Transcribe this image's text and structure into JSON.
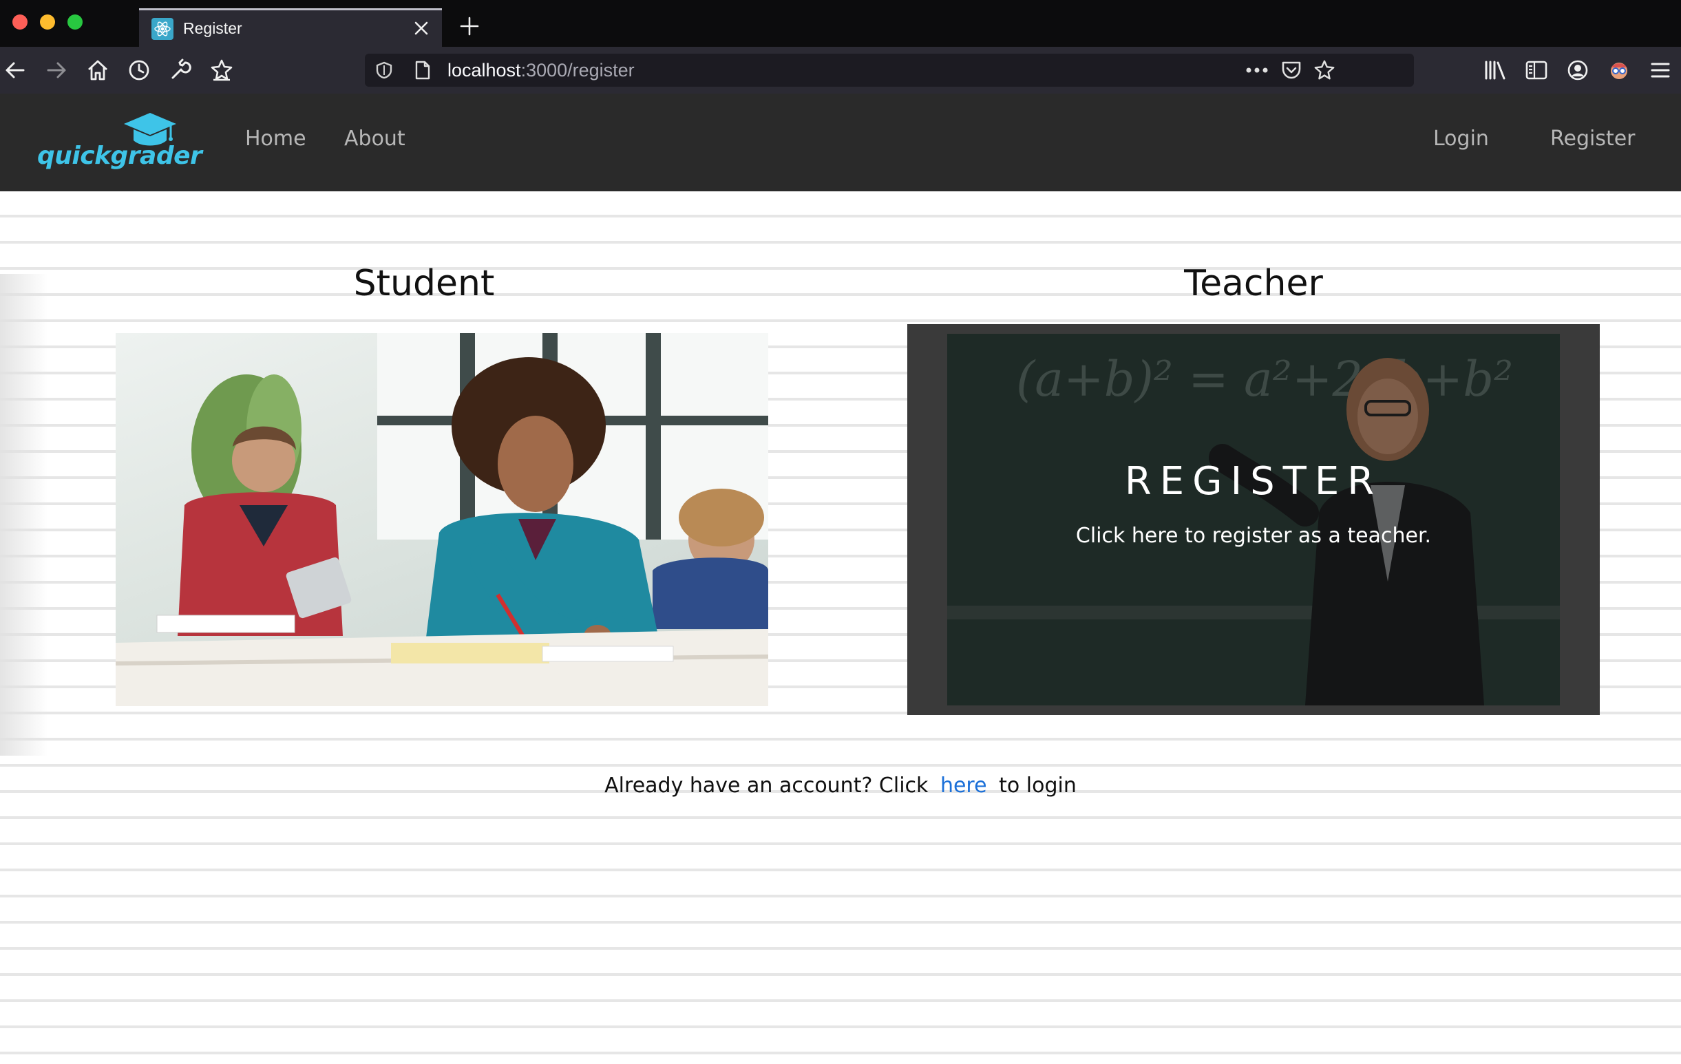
{
  "browser": {
    "tab_title": "Register",
    "url_host": "localhost",
    "url_rest": ":3000/register",
    "icons": [
      "back-icon",
      "forward-icon",
      "home-icon",
      "history-icon",
      "wrench-icon",
      "bookmark-star-icon",
      "more-icon",
      "pocket-icon",
      "star-icon",
      "library-icon",
      "sidebar-icon",
      "account-icon",
      "extension-icon",
      "menu-icon"
    ]
  },
  "site": {
    "logo_text": "quickgrader",
    "nav": {
      "home": "Home",
      "about": "About",
      "login": "Login",
      "register": "Register"
    },
    "accent_color": "#3ec4e8"
  },
  "main": {
    "student_title": "Student",
    "teacher_title": "Teacher",
    "teacher_card": {
      "heading": "REGISTER",
      "description": "Click here to register as a teacher."
    },
    "chalkboard_text": "(a+b)² = a²+2ab+b²",
    "footer": {
      "prefix": "Already have an account? Click",
      "link": "here",
      "suffix": "to login"
    }
  }
}
